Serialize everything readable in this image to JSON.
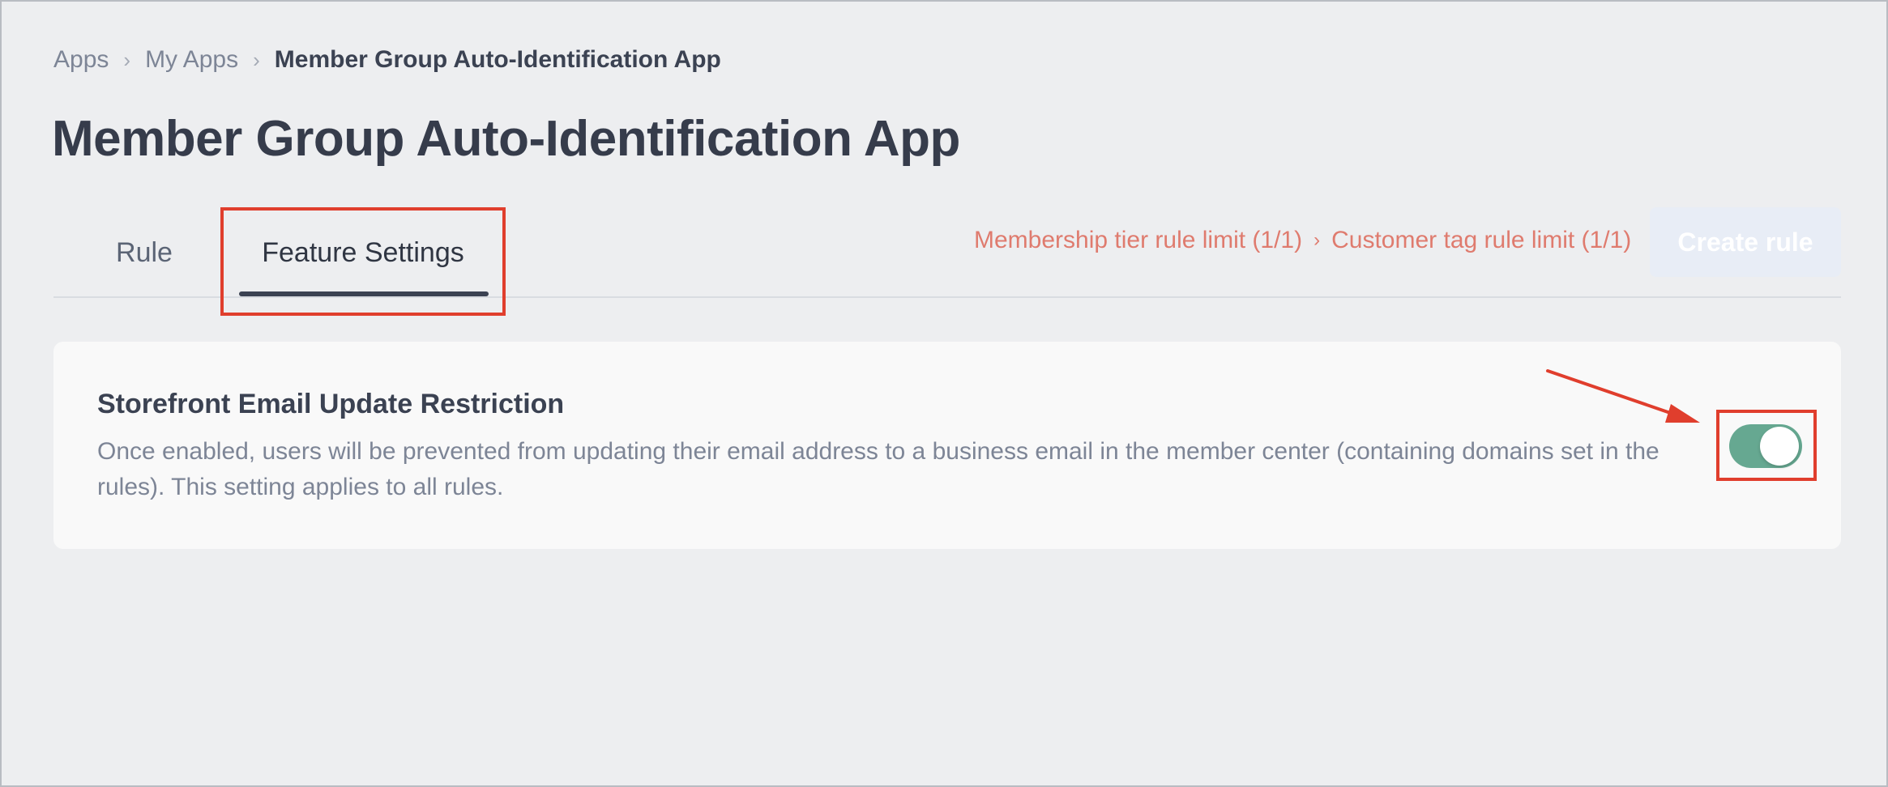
{
  "breadcrumb": {
    "apps": "Apps",
    "my_apps": "My Apps",
    "current": "Member Group Auto-Identification App",
    "separator": "›"
  },
  "page": {
    "title": "Member Group Auto-Identification App"
  },
  "tabs": [
    {
      "label": "Rule",
      "active": false
    },
    {
      "label": "Feature Settings",
      "active": true
    }
  ],
  "limits": {
    "membership": "Membership tier rule limit (1/1)",
    "separator": "›",
    "customer_tag": "Customer tag rule limit (1/1)"
  },
  "actions": {
    "create_rule": "Create rule",
    "create_rule_disabled": true
  },
  "settings": {
    "email_restriction": {
      "title": "Storefront Email Update Restriction",
      "description": "Once enabled, users will be prevented from updating their email address to a business email in the member center (containing domains set in the rules). This setting applies to all rules.",
      "enabled": true
    }
  },
  "colors": {
    "background": "#edeef0",
    "card": "#f9f9f9",
    "limit_text": "#df7b6e",
    "toggle_on": "#66a891",
    "annotation": "#e03e2d",
    "create_button": "#e8edf6"
  },
  "icons": {
    "breadcrumb_separator": "chevron-right-icon",
    "annotation_arrow": "arrow-icon"
  }
}
